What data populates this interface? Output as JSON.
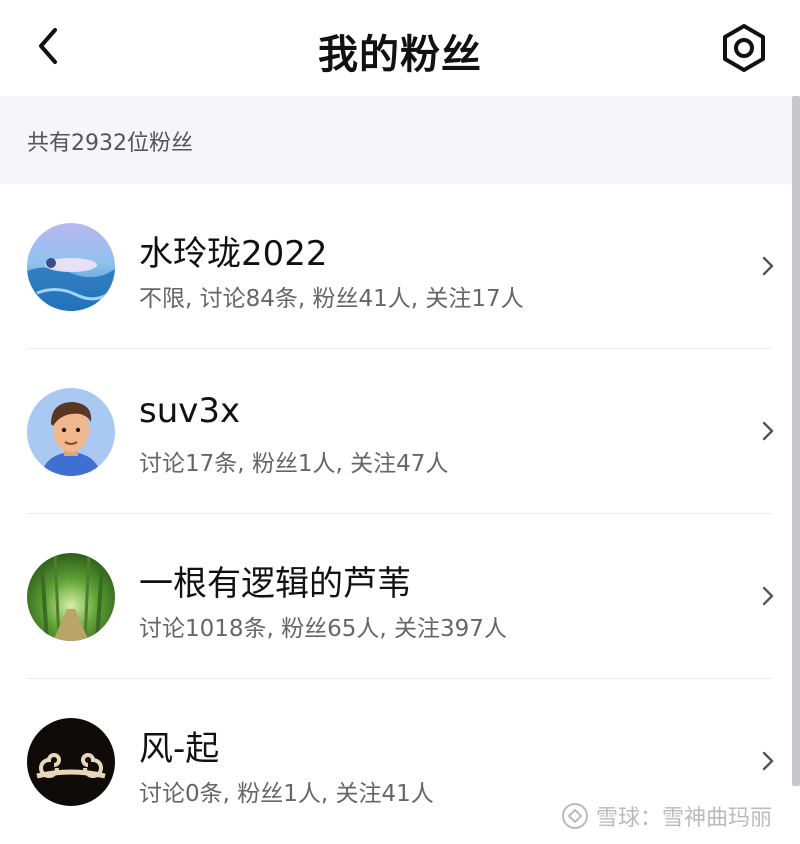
{
  "header": {
    "title": "我的粉丝",
    "back_icon": "chevron-left-icon",
    "settings_icon": "gear-icon"
  },
  "summary": {
    "count_text": "共有2932位粉丝"
  },
  "fans": [
    {
      "name": "水玲珑2022",
      "stats": "不限, 讨论84条, 粉丝41人, 关注17人",
      "avatar": "ocean-swimmer-avatar"
    },
    {
      "name": "suv3x",
      "stats": "讨论17条, 粉丝1人, 关注47人",
      "avatar": "cartoon-man-avatar"
    },
    {
      "name": "一根有逻辑的芦苇",
      "stats": "讨论1018条, 粉丝65人, 关注397人",
      "avatar": "bamboo-forest-avatar"
    },
    {
      "name": "风-起",
      "stats": "讨论0条, 粉丝1人, 关注41人",
      "avatar": "swirl-cloud-avatar"
    }
  ],
  "watermark": {
    "text": "雪球：雪神曲玛丽"
  },
  "colors": {
    "summary_bg": "#f5f5fa",
    "divider": "#ececec",
    "secondary_text": "#666666"
  }
}
